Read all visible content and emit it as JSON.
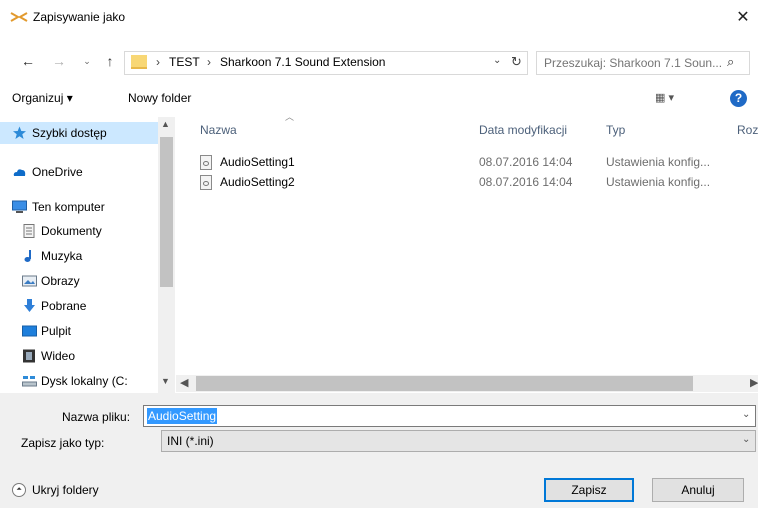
{
  "window": {
    "title": "Zapisywanie jako",
    "close_label": "✕",
    "title_icon": "sharkoon-app-icon"
  },
  "address": {
    "back": "←",
    "forward": "→",
    "recent": "⌄",
    "up": "↑",
    "breadcrumb_sep": "›",
    "crumbs": [
      "TEST",
      "Sharkoon 7.1 Sound Extension"
    ],
    "dropdown": "⌄",
    "refresh": "↻"
  },
  "search": {
    "placeholder": "Przeszukaj: Sharkoon 7.1 Soun...",
    "icon": "⌕"
  },
  "toolbar": {
    "organize_label": "Organizuj ▾",
    "new_folder_label": "Nowy folder",
    "view_label": "▦ ▾",
    "help_label": "?"
  },
  "nav": {
    "items": [
      {
        "label": "Szybki dostęp",
        "icon": "star-icon"
      },
      {
        "label": "OneDrive",
        "icon": "cloud-icon"
      },
      {
        "label": "Ten komputer",
        "icon": "computer-icon"
      },
      {
        "label": "Dokumenty",
        "icon": "document-icon"
      },
      {
        "label": "Muzyka",
        "icon": "music-icon"
      },
      {
        "label": "Obrazy",
        "icon": "pictures-icon"
      },
      {
        "label": "Pobrane",
        "icon": "download-icon"
      },
      {
        "label": "Pulpit",
        "icon": "desktop-icon"
      },
      {
        "label": "Wideo",
        "icon": "video-icon"
      },
      {
        "label": "Dysk lokalny (C:",
        "icon": "drive-icon"
      }
    ]
  },
  "files": {
    "columns": [
      "Nazwa",
      "Data modyfikacji",
      "Typ",
      "Rozi"
    ],
    "rows": [
      {
        "name": "AudioSetting1",
        "date": "08.07.2016 14:04",
        "type": "Ustawienia konfig..."
      },
      {
        "name": "AudioSetting2",
        "date": "08.07.2016 14:04",
        "type": "Ustawienia konfig..."
      }
    ]
  },
  "form": {
    "filename_label": "Nazwa pliku:",
    "filename_value": "AudioSetting",
    "type_label": "Zapisz jako typ:",
    "type_value": "INI (*.ini)",
    "dropdown": "⌄"
  },
  "footer": {
    "hide_folders_label": "Ukryj foldery",
    "hide_icon": "⏶",
    "save_label": "Zapisz",
    "cancel_label": "Anuluj"
  },
  "colors": {
    "selection": "#cce8ff",
    "accent": "#0078d7",
    "text_highlight": "#3399ff"
  }
}
